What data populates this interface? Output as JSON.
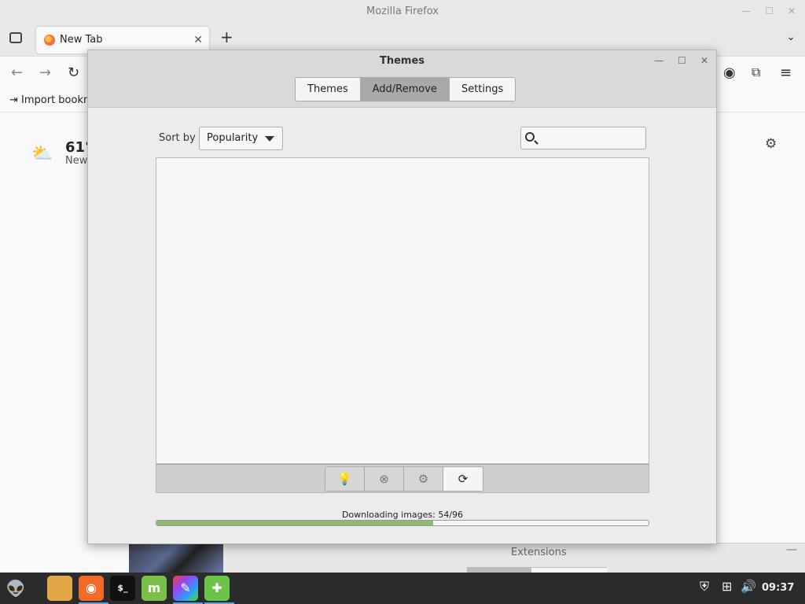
{
  "firefox": {
    "window_title": "Mozilla Firefox",
    "tab_label": "New Tab",
    "bookmark_label": "Import bookm",
    "weather_temp": "61°",
    "weather_location": "New"
  },
  "dialog": {
    "title": "Themes",
    "tabs": [
      {
        "label": "Themes",
        "active": false
      },
      {
        "label": "Add/Remove",
        "active": true
      },
      {
        "label": "Settings",
        "active": false
      }
    ],
    "sort_label": "Sort by",
    "sort_value": "Popularity",
    "search_value": "",
    "toolbar_buttons": [
      "info",
      "remove",
      "configure",
      "refresh"
    ],
    "progress": {
      "label": "Downloading images: 54/96",
      "done": 54,
      "total": 96
    }
  },
  "extensions_window": {
    "title": "Extensions"
  },
  "taskbar": {
    "clock": "09:37"
  }
}
